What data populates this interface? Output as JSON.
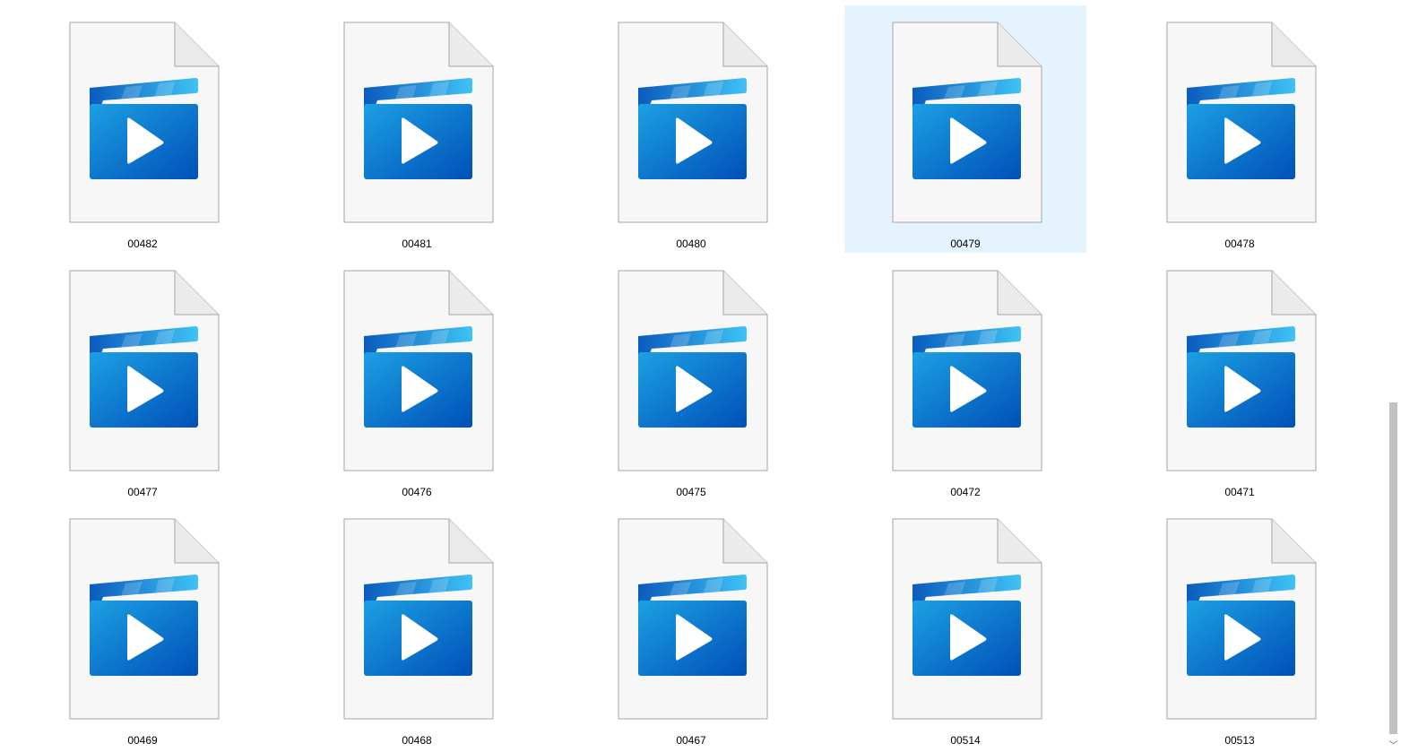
{
  "window": {
    "view_mode": "large-icons",
    "hover_item": "00479"
  },
  "colors": {
    "hover_bg": "#e5f3ff",
    "page_bg": "#ffffff",
    "doc_fill": "#f7f7f8",
    "doc_stroke": "#a6a6a6",
    "clapper_dark": "#0a5bbd",
    "clapper_light": "#3fc3f5",
    "clip_top": "#1ca0e3",
    "clip_bottom": "#0050b8",
    "play": "#ffffff",
    "scroll_thumb": "#c2c2c2"
  },
  "files": [
    {
      "name": "00482",
      "icon": "video-file-icon"
    },
    {
      "name": "00481",
      "icon": "video-file-icon"
    },
    {
      "name": "00480",
      "icon": "video-file-icon"
    },
    {
      "name": "00479",
      "icon": "video-file-icon"
    },
    {
      "name": "00478",
      "icon": "video-file-icon"
    },
    {
      "name": "00477",
      "icon": "video-file-icon"
    },
    {
      "name": "00476",
      "icon": "video-file-icon"
    },
    {
      "name": "00475",
      "icon": "video-file-icon"
    },
    {
      "name": "00472",
      "icon": "video-file-icon"
    },
    {
      "name": "00471",
      "icon": "video-file-icon"
    },
    {
      "name": "00469",
      "icon": "video-file-icon"
    },
    {
      "name": "00468",
      "icon": "video-file-icon"
    },
    {
      "name": "00467",
      "icon": "video-file-icon"
    },
    {
      "name": "00514",
      "icon": "video-file-icon"
    },
    {
      "name": "00513",
      "icon": "video-file-icon"
    }
  ],
  "scrollbar": {
    "down_glyph": "﹀"
  }
}
